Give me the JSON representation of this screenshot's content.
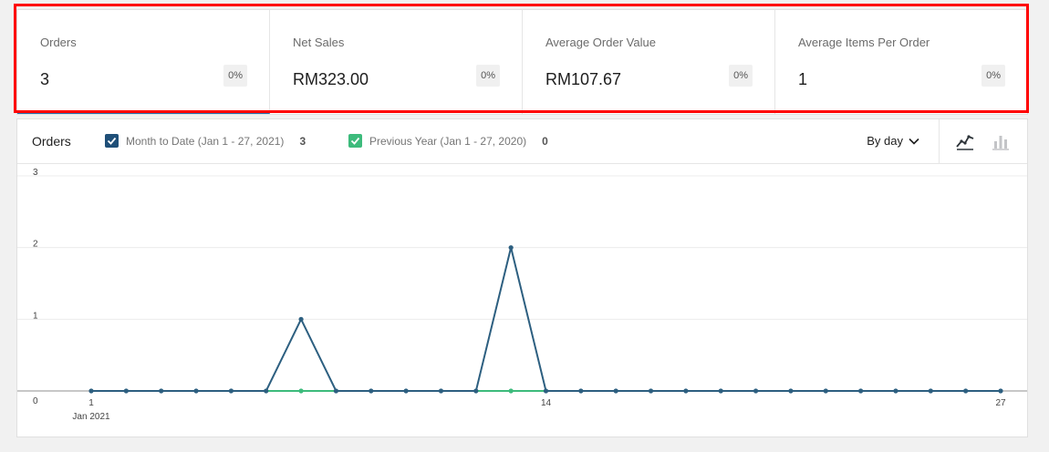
{
  "summary": {
    "cards": [
      {
        "label": "Orders",
        "value": "3",
        "delta": "0%"
      },
      {
        "label": "Net Sales",
        "value": "RM323.00",
        "delta": "0%"
      },
      {
        "label": "Average Order Value",
        "value": "RM107.67",
        "delta": "0%"
      },
      {
        "label": "Average Items Per Order",
        "value": "1",
        "delta": "0%"
      }
    ]
  },
  "chart_header": {
    "title": "Orders",
    "legend": [
      {
        "label": "Month to Date (Jan 1 - 27, 2021)",
        "total": "3",
        "color": "#1f4f78"
      },
      {
        "label": "Previous Year (Jan 1 - 27, 2020)",
        "total": "0",
        "color": "#3dbb7c"
      }
    ],
    "interval_label": "By day",
    "chart_type_icons": [
      "line-chart-icon",
      "bar-chart-icon"
    ]
  },
  "chart_data": {
    "type": "line",
    "x": [
      1,
      2,
      3,
      4,
      5,
      6,
      7,
      8,
      9,
      10,
      11,
      12,
      13,
      14,
      15,
      16,
      17,
      18,
      19,
      20,
      21,
      22,
      23,
      24,
      25,
      26,
      27
    ],
    "x_tick_labels": [
      "1",
      "14",
      "27"
    ],
    "x_sublabel": "Jan 2021",
    "ylim": [
      0,
      3
    ],
    "y_ticks": [
      "0",
      "1",
      "2",
      "3"
    ],
    "grid": true,
    "series": [
      {
        "name": "Month to Date (Jan 1 - 27, 2021)",
        "color": "#2d5f80",
        "values": [
          0,
          0,
          0,
          0,
          0,
          0,
          1,
          0,
          0,
          0,
          0,
          0,
          2,
          0,
          0,
          0,
          0,
          0,
          0,
          0,
          0,
          0,
          0,
          0,
          0,
          0,
          0
        ]
      },
      {
        "name": "Previous Year (Jan 1 - 27, 2020)",
        "color": "#3dbb7c",
        "values": [
          0,
          0,
          0,
          0,
          0,
          0,
          0,
          0,
          0,
          0,
          0,
          0,
          0,
          0,
          0,
          0,
          0,
          0,
          0,
          0,
          0,
          0,
          0,
          0,
          0,
          0,
          0
        ]
      }
    ]
  }
}
